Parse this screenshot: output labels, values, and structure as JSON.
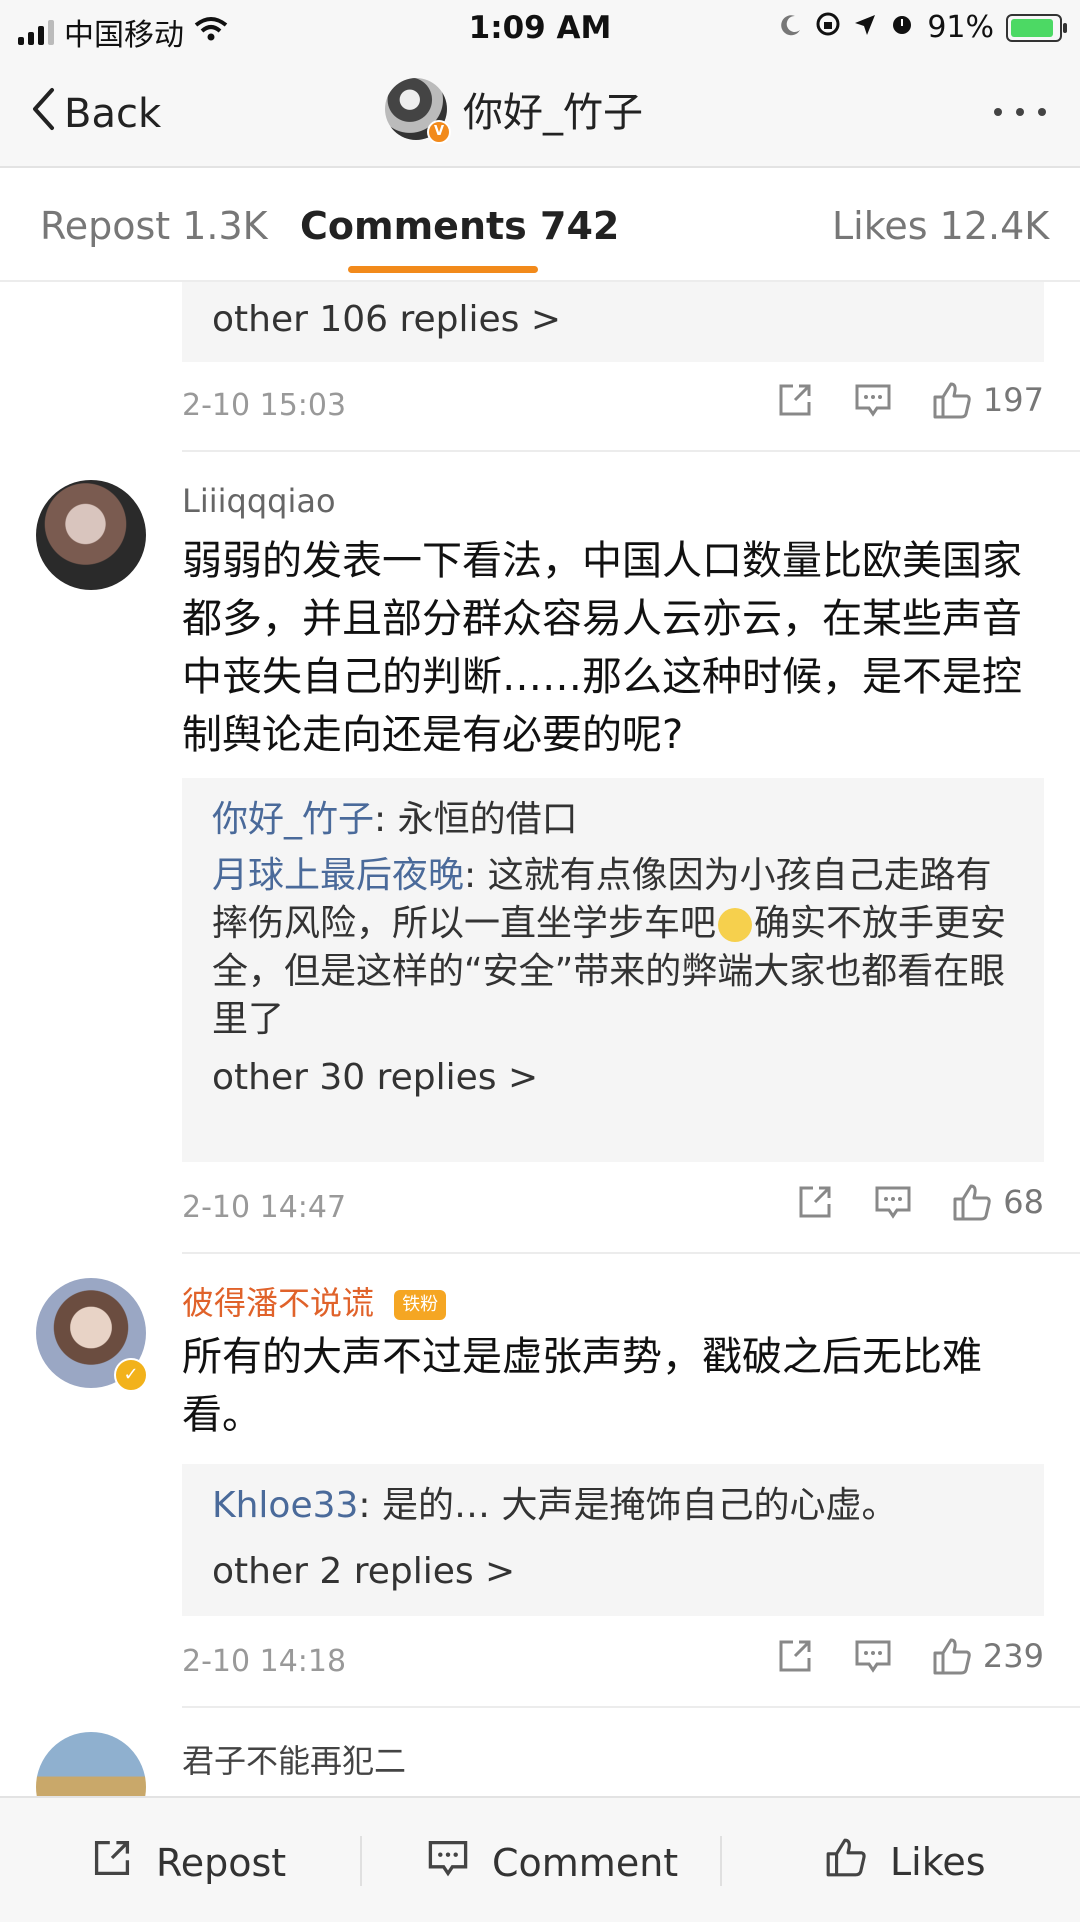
{
  "status": {
    "carrier": "中国移动",
    "time": "1:09 AM",
    "battery": "91%",
    "battery_level": 0.91
  },
  "nav": {
    "back": "Back",
    "title": "你好_竹子",
    "verified_badge": "V"
  },
  "tabs": [
    {
      "label": "Repost 1.3K"
    },
    {
      "label": "Comments 742"
    },
    {
      "label": "Likes 12.4K"
    }
  ],
  "comments": [
    {
      "more_replies": "other 106 replies >",
      "date": "2-10 15:03",
      "likes": "197"
    },
    {
      "user": "Liiiqqqiao",
      "text": "弱弱的发表一下看法，中国人口数量比欧美国家都多，并且部分群众容易人云亦云，在某些声音中丧失自己的判断……那么这种时候，是不是控制舆论走向还是有必要的呢?",
      "replies": [
        {
          "user": "你好_竹子",
          "text": ": 永恒的借口"
        },
        {
          "user": "月球上最后夜晚",
          "text_a": ": 这就有点像因为小孩自己走路有摔伤风险，所以一直坐学步车吧",
          "text_b": "确实不放手更安全，但是这样的“安全”带来的弊端大家也都看在眼里了"
        }
      ],
      "more_replies": "other 30 replies >",
      "date": "2-10 14:47",
      "likes": "68"
    },
    {
      "user": "彼得潘不说谎",
      "badge": "铁粉",
      "text": "所有的大声不过是虚张声势，戳破之后无比难看。",
      "replies": [
        {
          "user": "Khloe33",
          "text": ": 是的… 大声是掩饰自己的心虚。"
        }
      ],
      "more_replies": "other 2 replies >",
      "date": "2-10 14:18",
      "likes": "239"
    },
    {
      "user": "君子不能再犯二"
    }
  ],
  "bottom": {
    "repost": "Repost",
    "comment": "Comment",
    "likes": "Likes"
  }
}
